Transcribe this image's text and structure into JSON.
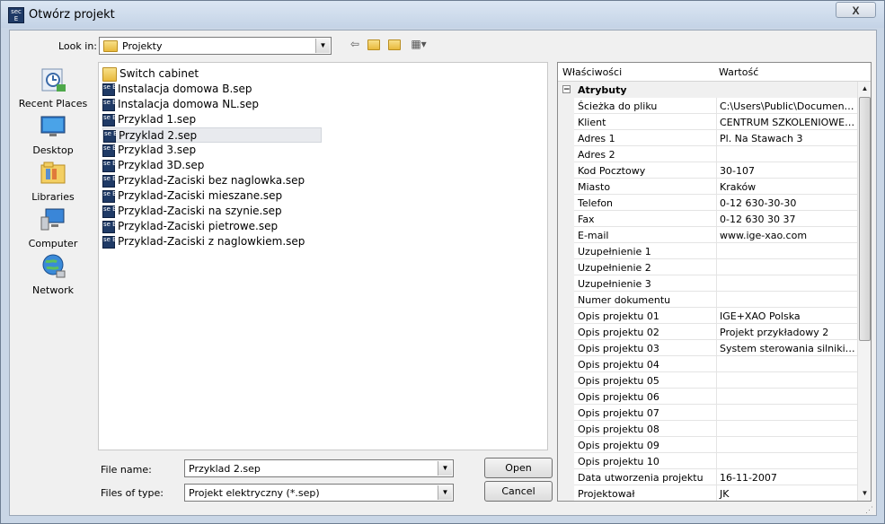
{
  "window": {
    "title": "Otwórz projekt",
    "close_label": "X",
    "app_icon_text": "sec E"
  },
  "lookin": {
    "label": "Look in:",
    "value": "Projekty"
  },
  "places": [
    {
      "label": "Recent Places",
      "icon": "recent-places-icon"
    },
    {
      "label": "Desktop",
      "icon": "desktop-icon"
    },
    {
      "label": "Libraries",
      "icon": "libraries-icon"
    },
    {
      "label": "Computer",
      "icon": "computer-icon"
    },
    {
      "label": "Network",
      "icon": "network-icon"
    }
  ],
  "files": [
    {
      "name": "Switch cabinet",
      "type": "folder"
    },
    {
      "name": "Instalacja domowa B.sep",
      "type": "sep"
    },
    {
      "name": "Instalacja domowa NL.sep",
      "type": "sep"
    },
    {
      "name": "Przyklad 1.sep",
      "type": "sep"
    },
    {
      "name": "Przyklad 2.sep",
      "type": "sep",
      "selected": true
    },
    {
      "name": "Przyklad 3.sep",
      "type": "sep"
    },
    {
      "name": "Przyklad 3D.sep",
      "type": "sep"
    },
    {
      "name": "Przyklad-Zaciski bez naglowka.sep",
      "type": "sep"
    },
    {
      "name": "Przyklad-Zaciski mieszane.sep",
      "type": "sep"
    },
    {
      "name": "Przyklad-Zaciski na szynie.sep",
      "type": "sep"
    },
    {
      "name": "Przyklad-Zaciski pietrowe.sep",
      "type": "sep"
    },
    {
      "name": "Przyklad-Zaciski z naglowkiem.sep",
      "type": "sep"
    }
  ],
  "filename": {
    "label": "File name:",
    "value": "Przyklad 2.sep"
  },
  "filetype": {
    "label": "Files of type:",
    "value": "Projekt elektryczny (*.sep)"
  },
  "buttons": {
    "open": "Open",
    "cancel": "Cancel"
  },
  "properties": {
    "col_name": "Właściwości",
    "col_value": "Wartość",
    "section": "Atrybuty",
    "collapse_symbol": "−",
    "rows": [
      {
        "k": "Ścieżka do pliku",
        "v": "C:\\Users\\Public\\Documents\\I..."
      },
      {
        "k": "Klient",
        "v": "CENTRUM SZKOLENIOWE IG..."
      },
      {
        "k": "Adres 1",
        "v": "Pl. Na Stawach 3"
      },
      {
        "k": "Adres 2",
        "v": ""
      },
      {
        "k": "Kod Pocztowy",
        "v": "30-107"
      },
      {
        "k": "Miasto",
        "v": " Kraków"
      },
      {
        "k": "Telefon",
        "v": "0-12 630-30-30"
      },
      {
        "k": "Fax",
        "v": "0-12 630 30 37"
      },
      {
        "k": "E-mail",
        "v": "www.ige-xao.com"
      },
      {
        "k": "Uzupełnienie 1",
        "v": ""
      },
      {
        "k": "Uzupełnienie 2",
        "v": ""
      },
      {
        "k": "Uzupełnienie 3",
        "v": ""
      },
      {
        "k": "Numer dokumentu",
        "v": ""
      },
      {
        "k": "Opis projektu 01",
        "v": "IGE+XAO Polska"
      },
      {
        "k": "Opis projektu 02",
        "v": "Projekt przykładowy 2"
      },
      {
        "k": "Opis projektu 03",
        "v": "System sterowania silnikiem"
      },
      {
        "k": "Opis projektu 04",
        "v": ""
      },
      {
        "k": "Opis projektu 05",
        "v": ""
      },
      {
        "k": "Opis projektu 06",
        "v": ""
      },
      {
        "k": "Opis projektu 07",
        "v": ""
      },
      {
        "k": "Opis projektu 08",
        "v": ""
      },
      {
        "k": "Opis projektu 09",
        "v": ""
      },
      {
        "k": "Opis projektu 10",
        "v": ""
      },
      {
        "k": "Data utworzenia projektu",
        "v": "16-11-2007"
      },
      {
        "k": "Projektował",
        "v": "JK"
      }
    ]
  },
  "colors": {
    "accent": "#1f3a66",
    "window_frame": "#c9d6e6",
    "dialog_bg": "#f0f0f0"
  }
}
